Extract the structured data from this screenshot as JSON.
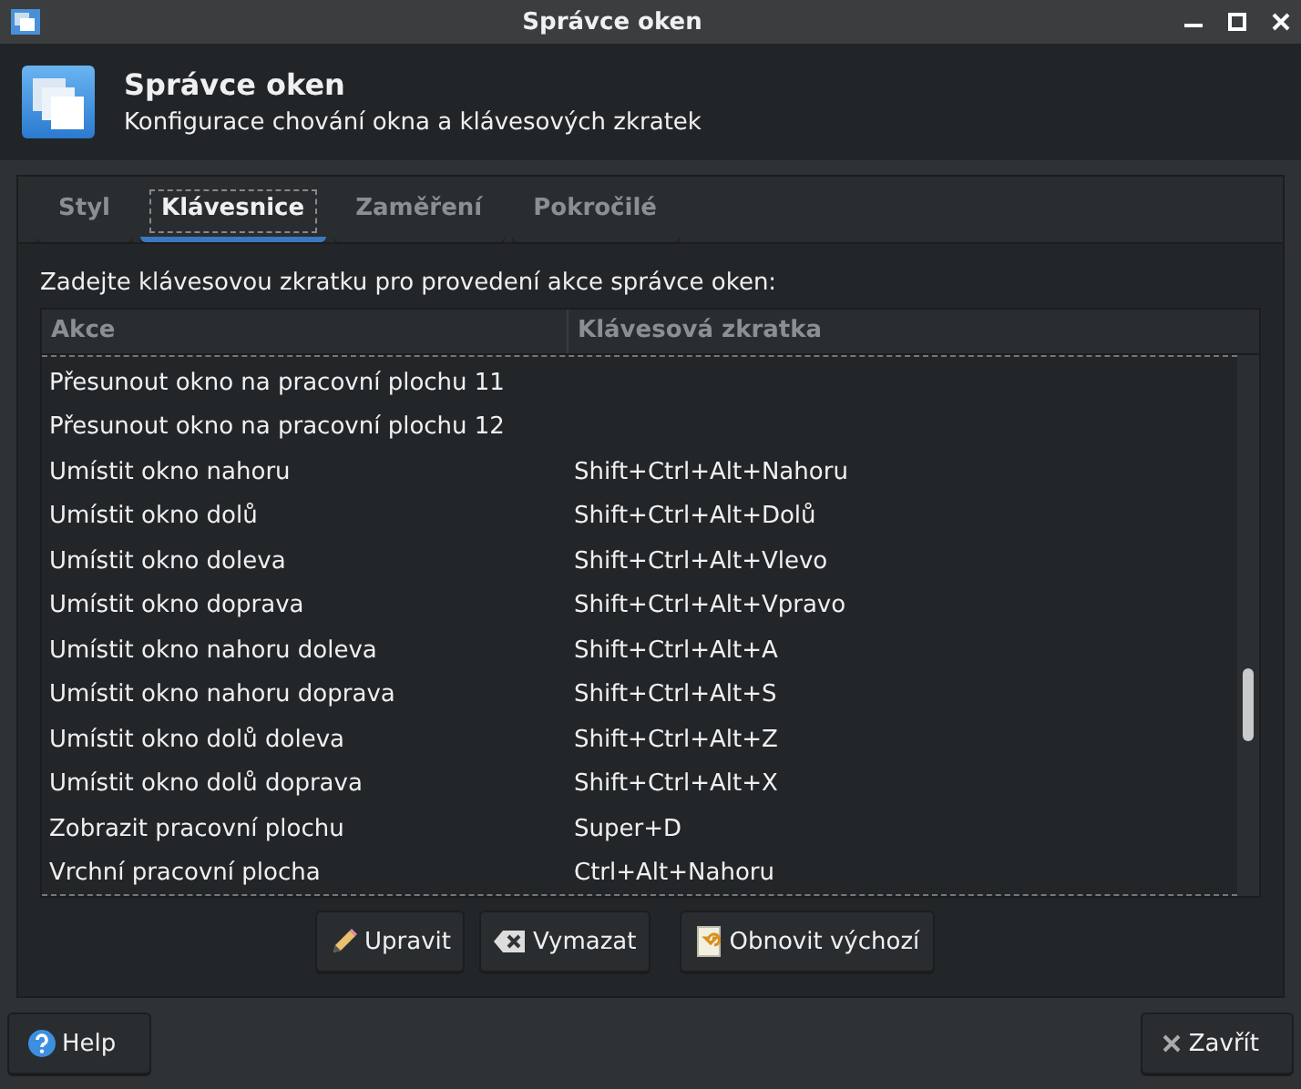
{
  "window": {
    "title": "Správce oken"
  },
  "header": {
    "title": "Správce oken",
    "subtitle": "Konfigurace chování okna a klávesových zkratek"
  },
  "tabs": [
    {
      "label": "Styl",
      "selected": false
    },
    {
      "label": "Klávesnice",
      "selected": true
    },
    {
      "label": "Zaměření",
      "selected": false
    },
    {
      "label": "Pokročilé",
      "selected": false
    }
  ],
  "instruction": "Zadejte klávesovou zkratku pro provedení akce správce oken:",
  "table": {
    "columns": [
      "Akce",
      "Klávesová zkratka"
    ],
    "rows": [
      [
        "Přesunout okno na pracovní plochu 11",
        ""
      ],
      [
        "Přesunout okno na pracovní plochu 12",
        ""
      ],
      [
        "Umístit okno nahoru",
        "Shift+Ctrl+Alt+Nahoru"
      ],
      [
        "Umístit okno dolů",
        "Shift+Ctrl+Alt+Dolů"
      ],
      [
        "Umístit okno doleva",
        "Shift+Ctrl+Alt+Vlevo"
      ],
      [
        "Umístit okno doprava",
        "Shift+Ctrl+Alt+Vpravo"
      ],
      [
        "Umístit okno nahoru doleva",
        "Shift+Ctrl+Alt+A"
      ],
      [
        "Umístit okno nahoru doprava",
        "Shift+Ctrl+Alt+S"
      ],
      [
        "Umístit okno dolů doleva",
        "Shift+Ctrl+Alt+Z"
      ],
      [
        "Umístit okno dolů doprava",
        "Shift+Ctrl+Alt+X"
      ],
      [
        "Zobrazit pracovní plochu",
        "Super+D"
      ],
      [
        "Vrchní pracovní plocha",
        "Ctrl+Alt+Nahoru"
      ]
    ]
  },
  "actions": [
    {
      "kind": "edit",
      "label": "Upravit"
    },
    {
      "kind": "clear",
      "label": "Vymazat"
    },
    {
      "kind": "reset",
      "label": "Obnovit výchozí"
    }
  ],
  "footer": [
    {
      "kind": "help",
      "label": "Help"
    },
    {
      "kind": "close",
      "label": "Zavřít"
    }
  ]
}
